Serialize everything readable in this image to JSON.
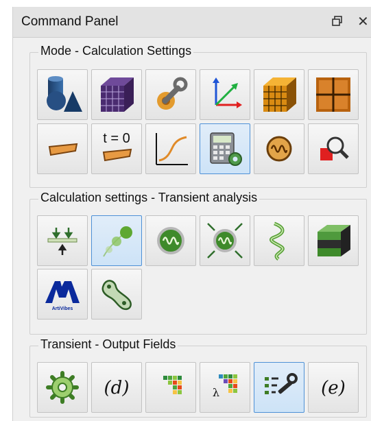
{
  "panel": {
    "title": "Command Panel",
    "float_glyph": "❐",
    "close_glyph": "✕"
  },
  "groups": [
    {
      "label": "Mode - Calculation Settings",
      "buttons": [
        {
          "icon": "geometry-shapes-icon",
          "active": false
        },
        {
          "icon": "mesh-cube-icon",
          "active": false
        },
        {
          "icon": "material-tools-icon",
          "active": false
        },
        {
          "icon": "coordinate-axes-icon",
          "active": false
        },
        {
          "icon": "orange-mesh-cube-icon",
          "active": false
        },
        {
          "icon": "grid-plane-icon",
          "active": false
        },
        {
          "icon": "beam-element-icon",
          "active": false
        },
        {
          "icon": "initial-condition-icon",
          "active": false
        },
        {
          "icon": "curve-graph-icon",
          "active": false
        },
        {
          "icon": "calculation-settings-icon",
          "active": true
        },
        {
          "icon": "vibration-mode-icon",
          "active": false
        },
        {
          "icon": "inspect-result-icon",
          "active": false
        }
      ]
    },
    {
      "label": "Calculation settings - Transient analysis",
      "buttons": [
        {
          "icon": "boundary-load-icon",
          "active": false
        },
        {
          "icon": "transient-motion-icon",
          "active": true
        },
        {
          "icon": "oscillator-icon",
          "active": false
        },
        {
          "icon": "excitation-oscillator-icon",
          "active": false
        },
        {
          "icon": "spring-twist-icon",
          "active": false
        },
        {
          "icon": "layered-solid-icon",
          "active": false
        },
        {
          "icon": "logo-brand-icon",
          "active": false,
          "logo_text": "ArtiVibes"
        },
        {
          "icon": "bone-structure-icon",
          "active": false
        }
      ]
    },
    {
      "label": "Transient - Output Fields",
      "buttons": [
        {
          "icon": "output-settings-gear-icon",
          "active": false
        },
        {
          "icon": "displacement-field-icon",
          "active": false,
          "math": "(d)"
        },
        {
          "icon": "color-field-map-icon",
          "active": false
        },
        {
          "icon": "eigen-field-map-icon",
          "active": false,
          "lambda": "λ"
        },
        {
          "icon": "field-options-tools-icon",
          "active": true
        },
        {
          "icon": "strain-field-icon",
          "active": false,
          "math": "(e)"
        }
      ]
    }
  ],
  "colors": {
    "accent_active_border": "#4d90d6",
    "active_background": "#d7e8f8",
    "panel_background": "#f0f0f0"
  }
}
